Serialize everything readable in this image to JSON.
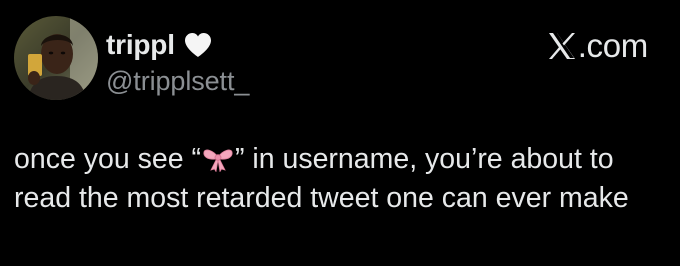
{
  "author": {
    "display_name": "trippl",
    "handle": "@tripplsett_",
    "name_emoji_icon": "white-heart-icon"
  },
  "brand": {
    "logo_icon": "x-logo-icon",
    "suffix": ".com"
  },
  "tweet": {
    "line1_before": "once you see “",
    "emoji_icon": "ribbon-bow-emoji-icon",
    "line1_after": "” in username, you’re about to",
    "line2": "read the most retarded tweet one can ever make"
  },
  "colors": {
    "background": "#000000",
    "text_primary": "#e7e9ea",
    "text_secondary": "#8b8f93",
    "bow_pink": "#f4a7bd"
  }
}
